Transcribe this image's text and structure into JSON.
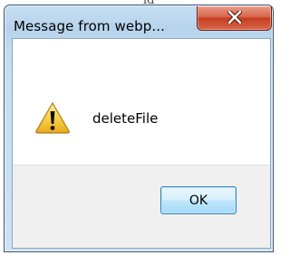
{
  "dialog": {
    "title": "Message from webp...",
    "message": "deleteFile",
    "ok_label": "OK",
    "icon": "warning-icon",
    "close_icon": "close-icon"
  },
  "colors": {
    "title_bar": "#b6d3ec",
    "close_button": "#c43d20",
    "ok_button_border": "#3c7fb1",
    "warning_yellow": "#f2c12e"
  }
}
